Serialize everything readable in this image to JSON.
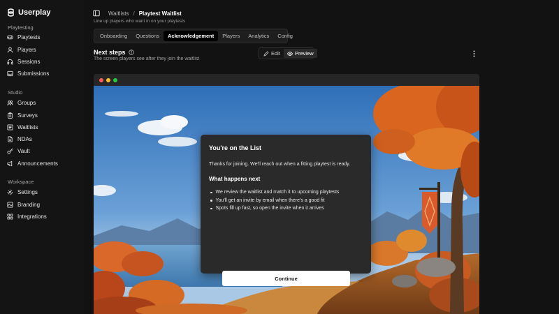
{
  "app": {
    "brand": "Userplay"
  },
  "sidebar": {
    "sections": [
      {
        "label": "Playtesting",
        "items": [
          {
            "label": "Playtests",
            "icon": "gamepad-icon"
          },
          {
            "label": "Players",
            "icon": "user-icon"
          },
          {
            "label": "Sessions",
            "icon": "headset-icon"
          },
          {
            "label": "Submissions",
            "icon": "inbox-icon"
          }
        ]
      },
      {
        "label": "Studio",
        "items": [
          {
            "label": "Groups",
            "icon": "users-icon"
          },
          {
            "label": "Surveys",
            "icon": "clipboard-icon"
          },
          {
            "label": "Waitlists",
            "icon": "list-icon"
          },
          {
            "label": "NDAs",
            "icon": "document-icon"
          },
          {
            "label": "Vault",
            "icon": "key-icon"
          },
          {
            "label": "Announcements",
            "icon": "megaphone-icon"
          }
        ]
      },
      {
        "label": "Workspace",
        "items": [
          {
            "label": "Settings",
            "icon": "gear-icon"
          },
          {
            "label": "Branding",
            "icon": "palette-icon"
          },
          {
            "label": "Integrations",
            "icon": "plug-icon"
          }
        ]
      }
    ]
  },
  "header": {
    "breadcrumb_parent": "Waitlists",
    "breadcrumb_separator": "/",
    "breadcrumb_current": "Playtest Waitlist",
    "subtitle": "Line up players who want in on your playtests"
  },
  "tabs": [
    {
      "label": "Onboarding",
      "active": false
    },
    {
      "label": "Questions",
      "active": false
    },
    {
      "label": "Acknowledgement",
      "active": true
    },
    {
      "label": "Players",
      "active": false
    },
    {
      "label": "Analytics",
      "active": false
    },
    {
      "label": "Config",
      "active": false
    }
  ],
  "section": {
    "title": "Next steps",
    "description": "The screen players see after they join the waitlist",
    "edit_label": "Edit",
    "preview_label": "Preview",
    "mode": "preview"
  },
  "preview": {
    "modal_title": "You're on the List",
    "modal_body": "Thanks for joining. We'll reach out when a fitting playtest is ready.",
    "modal_subtitle": "What happens next",
    "bullets": [
      "We review the waitlist and match it to upcoming playtests",
      "You'll get an invite by email when there's a good fit",
      "Spots fill up fast, so open the invite when it arrives"
    ],
    "continue_label": "Continue"
  },
  "colors": {
    "background": "#121212",
    "window_dot_red": "#ff5f57",
    "window_dot_yellow": "#febc2e",
    "window_dot_green": "#28c840",
    "banner": "#d95a2b"
  }
}
